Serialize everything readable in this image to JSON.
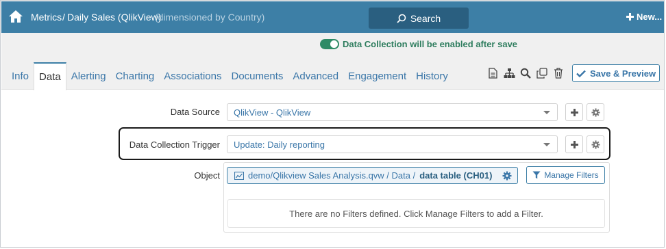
{
  "header": {
    "breadcrumb_metrics": "Metrics",
    "breadcrumb_sep": "/",
    "breadcrumb_title": "Daily Sales (QlikView)",
    "breadcrumb_sub": "(dimensioned by Country)",
    "search_label": "Search",
    "new_label": "New..."
  },
  "banner": {
    "data_collection_text": "Data Collection will be enabled after save",
    "toggle_on": true
  },
  "tabs": [
    {
      "label": "Info",
      "active": false
    },
    {
      "label": "Data",
      "active": true
    },
    {
      "label": "Alerting",
      "active": false
    },
    {
      "label": "Charting",
      "active": false
    },
    {
      "label": "Associations",
      "active": false
    },
    {
      "label": "Documents",
      "active": false
    },
    {
      "label": "Advanced",
      "active": false
    },
    {
      "label": "Engagement",
      "active": false
    },
    {
      "label": "History",
      "active": false
    }
  ],
  "toolbar": {
    "icons": [
      "document-icon",
      "hierarchy-icon",
      "search-icon",
      "copy-icon",
      "trash-icon"
    ],
    "save_label": "Save & Preview"
  },
  "form": {
    "data_source_label": "Data Source",
    "data_source_value": "QlikView - QlikView",
    "trigger_label": "Data Collection Trigger",
    "trigger_value": "Update: Daily reporting",
    "object_label": "Object",
    "object_path": "demo/Qlikview Sales Analysis.qvw / Data / ",
    "object_name": "data table (CH01)",
    "manage_filters_label": "Manage Filters",
    "no_filters_text": "There are no Filters defined. Click Manage Filters to add a Filter."
  },
  "colors": {
    "header_bg": "#3d7fa6",
    "accent": "#3a76a8",
    "toggle_green": "#2e8b66"
  }
}
